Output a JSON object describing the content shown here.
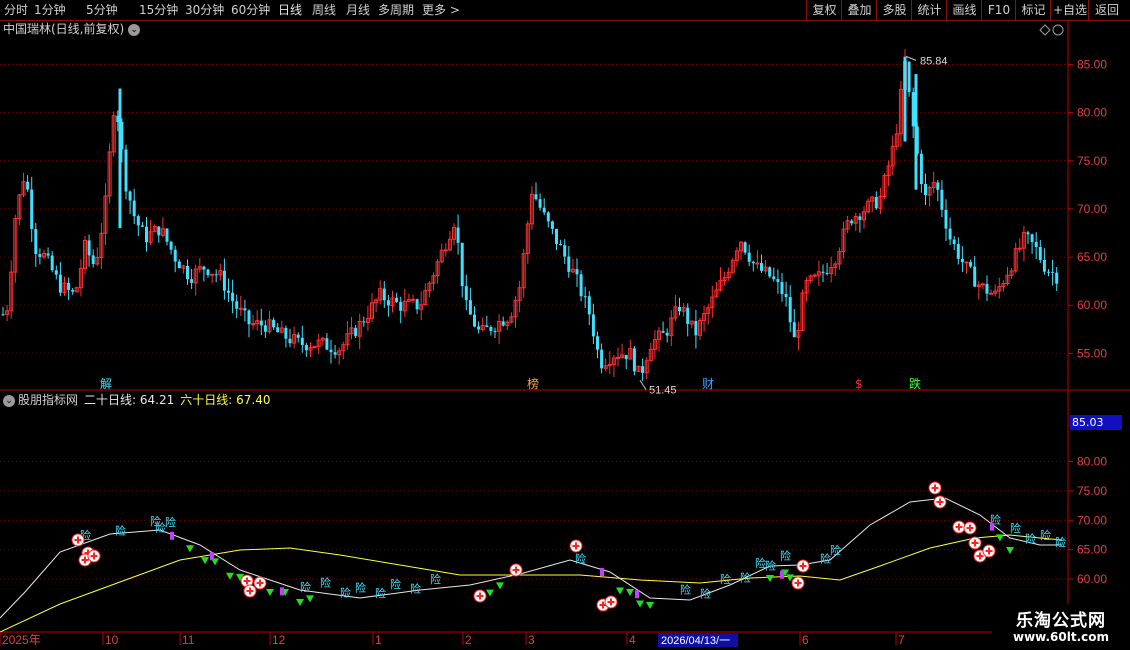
{
  "toolbar": {
    "periods": [
      "分时",
      "1分钟",
      "5分钟",
      "15分钟",
      "30分钟",
      "60分钟",
      "日线",
      "周线",
      "月线",
      "多周期",
      "更多 >"
    ],
    "active_period": "日线",
    "right_buttons": [
      "复权",
      "叠加",
      "多股",
      "统计",
      "画线",
      "F10",
      "+自选",
      "返回"
    ],
    "mark_label": "标记"
  },
  "main_chart": {
    "title": "中国瑞林(日线,前复权)",
    "y_ticks": [
      "85.00",
      "80.00",
      "75.00",
      "70.00",
      "65.00",
      "60.00",
      "55.00"
    ],
    "high_label": "85.84",
    "low_label": "51.45",
    "event_marks": [
      {
        "text": "解",
        "color": "#40e0ff"
      },
      {
        "text": "榜",
        "color": "#ffa040"
      },
      {
        "text": "财",
        "color": "#40a0ff"
      },
      {
        "text": "$",
        "color": "#ff3030"
      },
      {
        "text": "跌",
        "color": "#40ff40"
      }
    ],
    "colors": {
      "up": "#ff3030",
      "down": "#40e0ff",
      "grid": "#7a0000",
      "axis": "#c00000"
    }
  },
  "indicator": {
    "name": "股朋指标网",
    "ma20_label": "二十日线:",
    "ma20_value": "64.21",
    "ma60_label": "六十日线:",
    "ma60_value": "67.40",
    "y_ticks": [
      "80.00",
      "75.00",
      "70.00",
      "65.00",
      "60.00"
    ],
    "price_tag": "85.03",
    "marker_text": "险",
    "colors": {
      "ma20": "#e8e8e8",
      "ma60": "#ffff40",
      "risk": "#40e0ff",
      "buy": "#ff2020",
      "down_arrow": "#20e020",
      "purple": "#c040ff"
    }
  },
  "x_axis": {
    "labels": [
      "2025年",
      "10",
      "11",
      "12",
      "1",
      "2",
      "3",
      "4",
      "6",
      "7"
    ],
    "cursor_date": "2026/04/13/一"
  },
  "watermark": {
    "line1": "乐淘公式网",
    "line2": "www.60lt.com"
  }
}
